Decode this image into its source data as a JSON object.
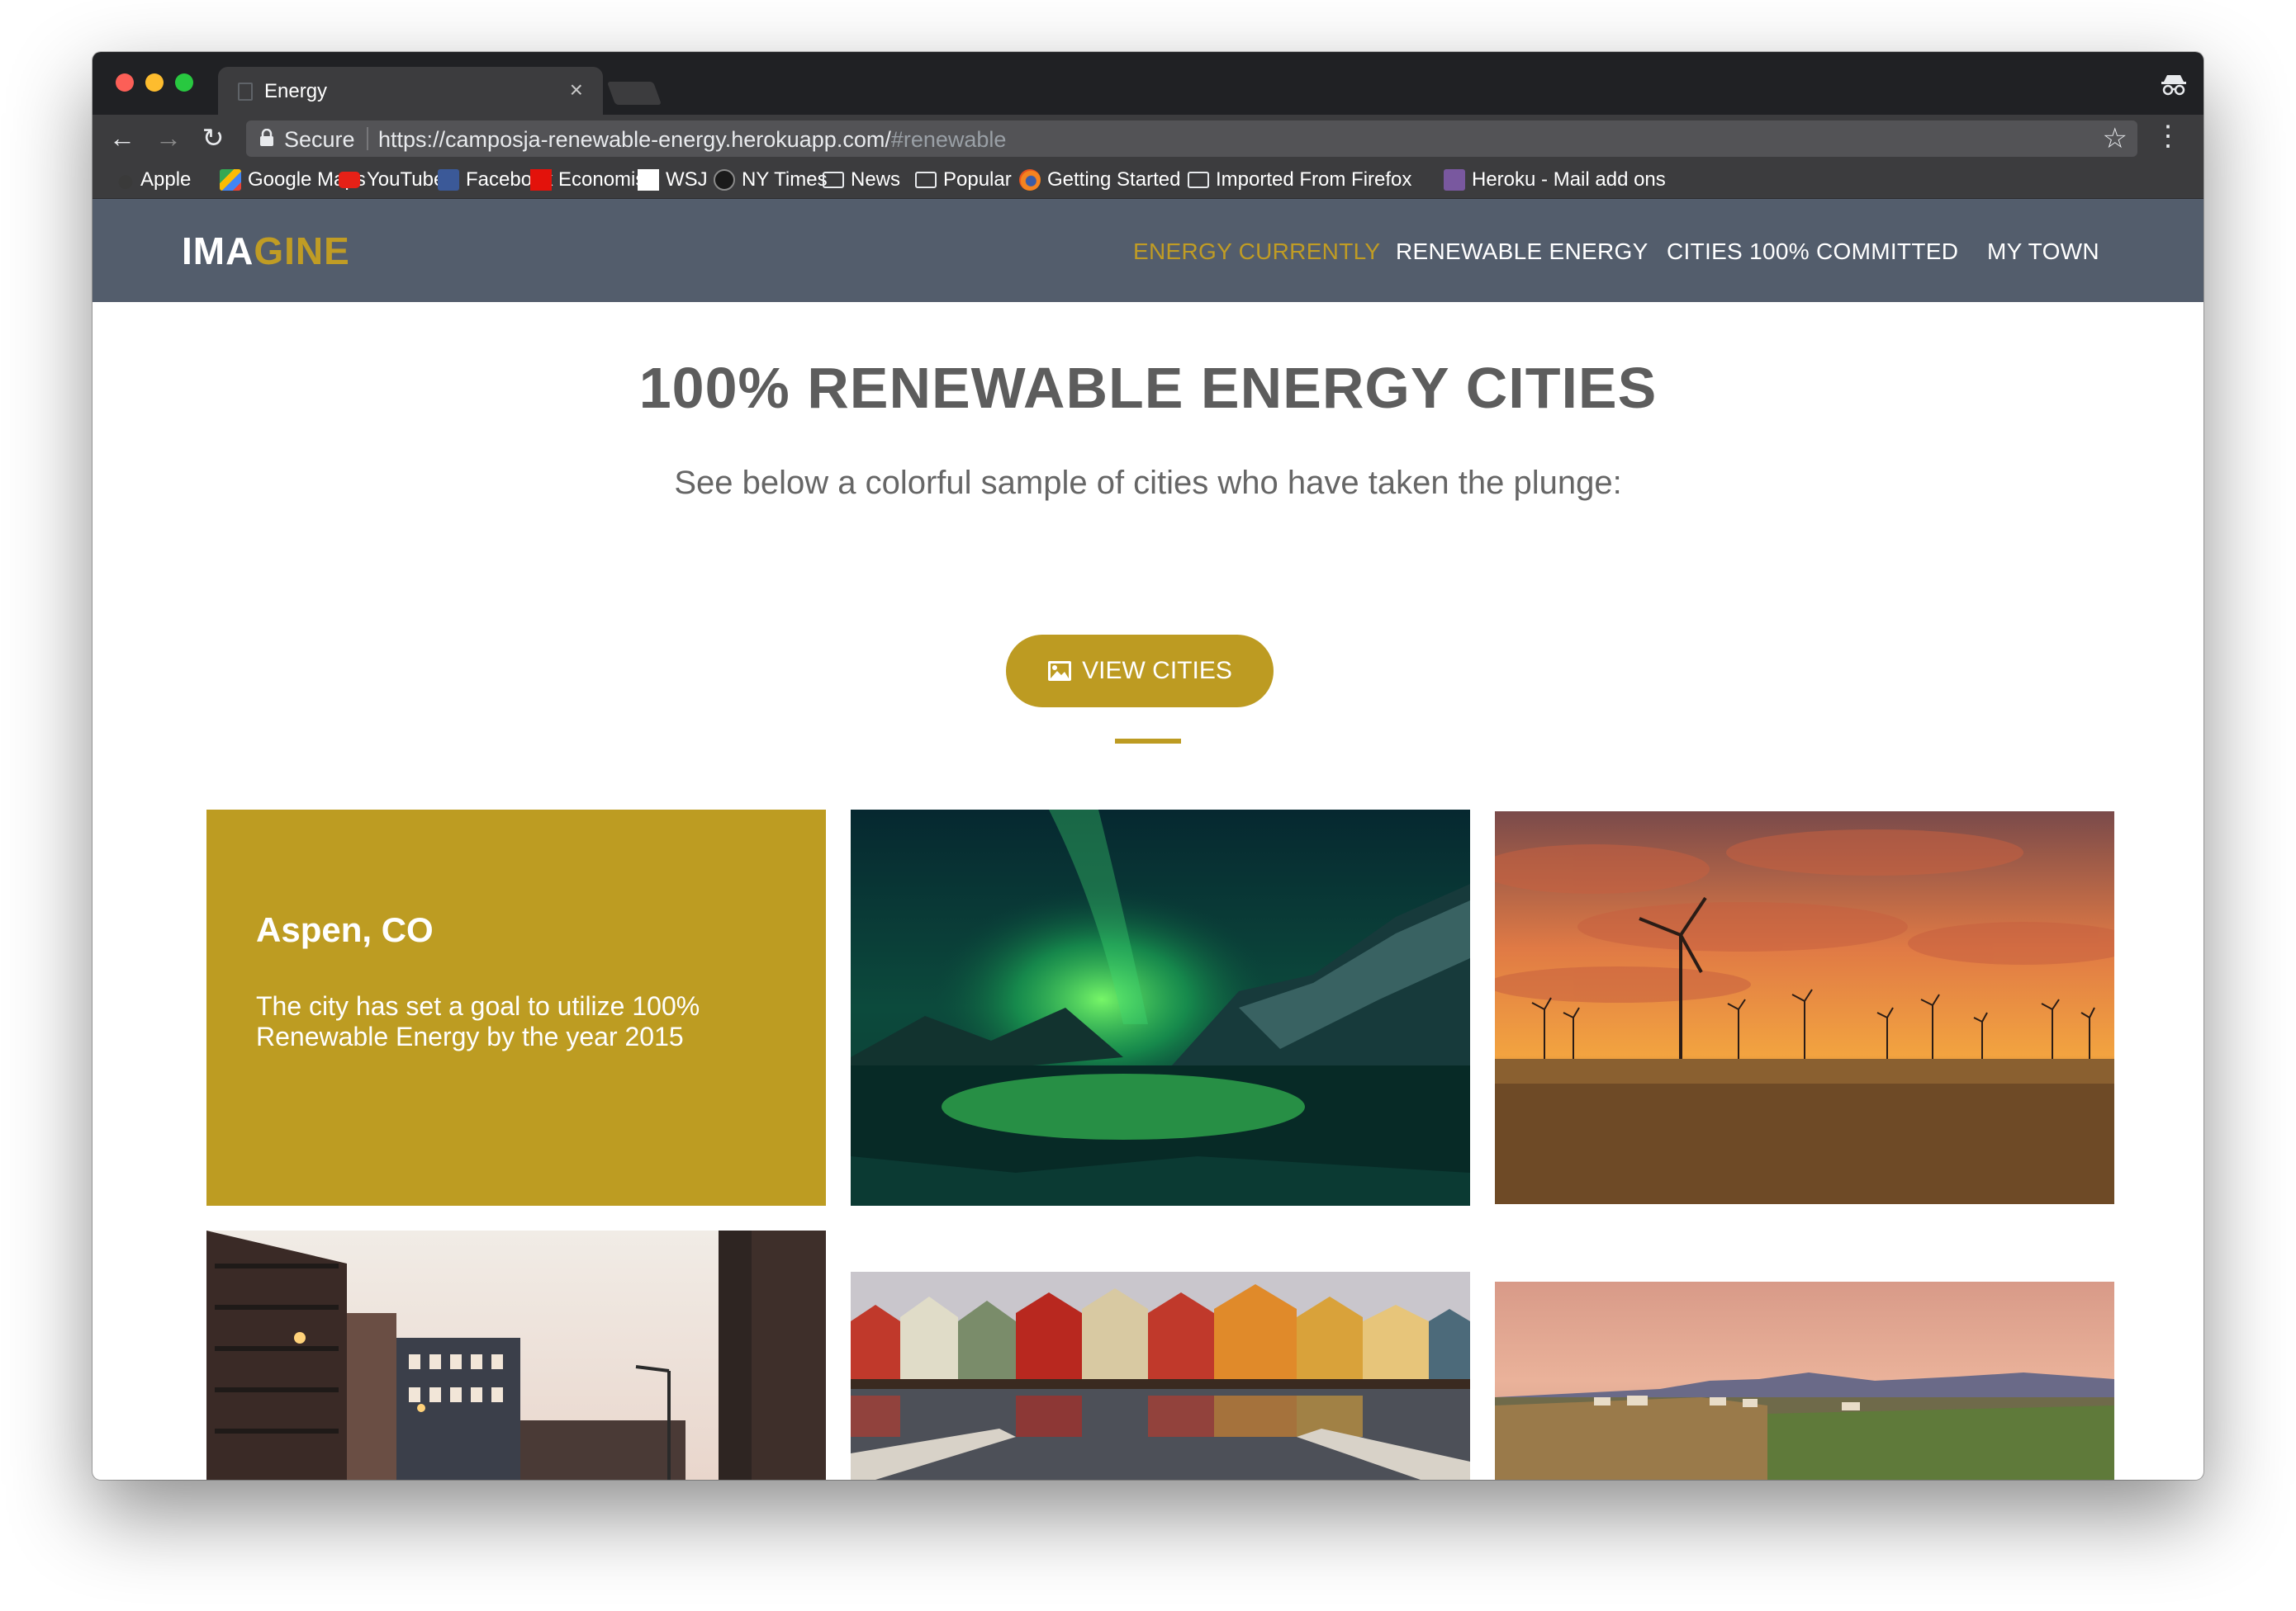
{
  "browser": {
    "tab_title": "Energy",
    "tab_close": "×",
    "secure_label": "Secure",
    "url_main": "https://camposja-renewable-energy.herokuapp.com/",
    "url_fragment": "#renewable",
    "bookmarks": [
      {
        "label": "Apple",
        "icon": "apple-icon"
      },
      {
        "label": "Google Maps",
        "icon": "google-maps-icon"
      },
      {
        "label": "YouTube",
        "icon": "youtube-icon"
      },
      {
        "label": "Facebook",
        "icon": "facebook-icon"
      },
      {
        "label": "Economist",
        "icon": "economist-icon"
      },
      {
        "label": "WSJ",
        "icon": "wsj-icon"
      },
      {
        "label": "NY Times",
        "icon": "nytimes-icon"
      },
      {
        "label": "News",
        "icon": "folder-icon"
      },
      {
        "label": "Popular",
        "icon": "folder-icon"
      },
      {
        "label": "Getting Started",
        "icon": "firefox-icon"
      },
      {
        "label": "Imported From Firefox",
        "icon": "folder-icon"
      },
      {
        "label": "Heroku - Mail add ons",
        "icon": "heroku-icon"
      }
    ]
  },
  "site": {
    "logo_part1": "IMA",
    "logo_part2": "GINE",
    "nav": [
      {
        "label": "ENERGY CURRENTLY",
        "active": true
      },
      {
        "label": "RENEWABLE ENERGY",
        "active": false
      },
      {
        "label": "CITIES 100% COMMITTED",
        "active": false
      },
      {
        "label": "MY TOWN",
        "active": false
      }
    ]
  },
  "main": {
    "headline": "100% RENEWABLE ENERGY CITIES",
    "subheadline": "See below a colorful sample of cities who have taken the plunge:",
    "view_button": "VIEW CITIES",
    "featured_city": {
      "name": "Aspen, CO",
      "description": "The city has set a goal to utilize 100% Renewable Energy by the year 2015"
    }
  },
  "colors": {
    "accent": "#bd9b22",
    "header_bg": "#535d6c",
    "headline": "#5d5d5d"
  }
}
